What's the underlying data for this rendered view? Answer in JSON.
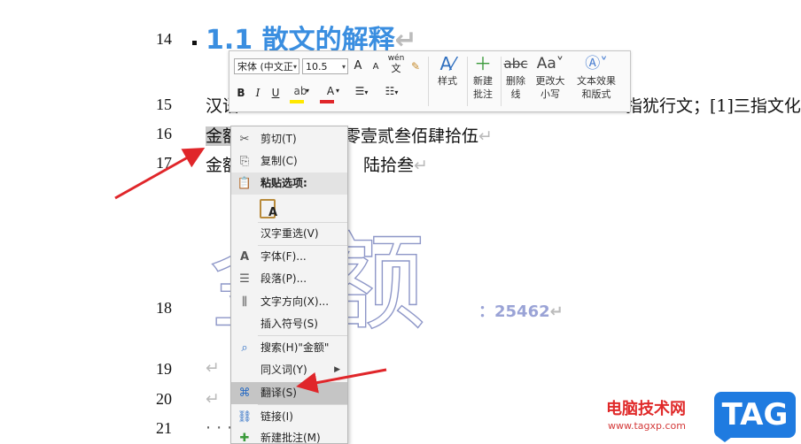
{
  "line_numbers": [
    "14",
    "15",
    "16",
    "17",
    "18",
    "19",
    "20",
    "21"
  ],
  "document": {
    "heading": "1.1 散文的解释",
    "para_mark": "↵",
    "line15_start": "汉语",
    "line15_end": "指犹行文；[1]三指文化",
    "line16_selected": "金额",
    "line16_rest": "零壹贰叁佰肆拾伍",
    "line17_start": "金额",
    "line17_rest": "陆拾叁",
    "line21_dots": "· · ·"
  },
  "watermark": {
    "text": "金额",
    "number": "：25462"
  },
  "mini_toolbar": {
    "font_name": "宋体 (中文正",
    "font_size": "10.5",
    "grow_font": "A",
    "shrink_font": "A",
    "phonetic": "wén",
    "bold": "B",
    "italic": "I",
    "underline": "U",
    "styles_label": "样式",
    "new_comment_label": "新建\n批注",
    "delete_line_label": "删除\n线",
    "change_case_label": "更改大\n小写",
    "text_effects_label": "文本效果\n和版式"
  },
  "context_menu": {
    "items": [
      {
        "label": "剪切(T)",
        "icon": "scissors-icon"
      },
      {
        "label": "复制(C)",
        "icon": "copy-icon"
      },
      {
        "label": "粘贴选项:",
        "icon": "paste-icon"
      },
      {
        "label": "汉字重选(V)",
        "icon": ""
      },
      {
        "label": "字体(F)...",
        "icon": "font-icon"
      },
      {
        "label": "段落(P)...",
        "icon": "paragraph-icon"
      },
      {
        "label": "文字方向(X)...",
        "icon": "text-direction-icon"
      },
      {
        "label": "插入符号(S)",
        "icon": ""
      },
      {
        "label": "搜索(H)\"金额\"",
        "icon": "search-icon"
      },
      {
        "label": "同义词(Y)",
        "icon": ""
      },
      {
        "label": "翻译(S)",
        "icon": "translate-icon"
      },
      {
        "label": "链接(I)",
        "icon": "link-icon"
      },
      {
        "label": "新建批注(M)",
        "icon": "new-comment-icon"
      }
    ]
  },
  "branding": {
    "site_name": "电脑技术网",
    "url": "www.tagxp.com",
    "tag": "TAG"
  },
  "colors": {
    "heading": "#3a8ee0",
    "arrow": "#e0262a",
    "highlight": "#c5c5c5",
    "watermark_outline": "#8e97c8",
    "tag_bg": "#1f7be0"
  }
}
